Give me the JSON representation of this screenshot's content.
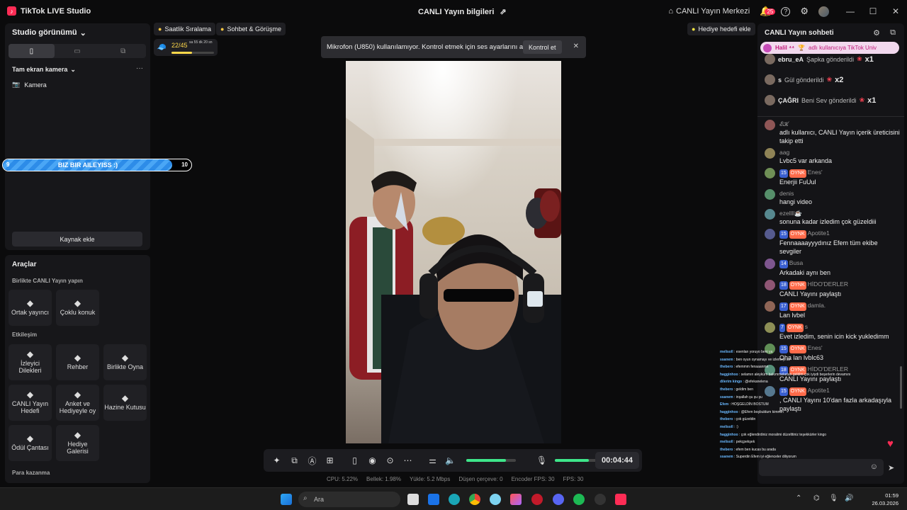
{
  "titlebar": {
    "app_title": "TikTok LIVE Studio",
    "center_title": "CANLI Yayın bilgileri",
    "live_center": "CANLI Yayın Merkezi",
    "notif_count": "25"
  },
  "left": {
    "studio_view": "Studio görünümü",
    "scene": "Tam ekran kamera",
    "source": "Kamera",
    "add_source": "Kaynak ekle",
    "banner_left": "9",
    "banner_text": "BIZ BIR AILEYISS :)",
    "banner_right": "10",
    "banner_progress": 0.9
  },
  "tools": {
    "title": "Araçlar",
    "together_title": "Birlikte CANLI Yayın yapın",
    "together": [
      {
        "label": "Ortak yayıncı",
        "icon": "link-icon"
      },
      {
        "label": "Çoklu konuk",
        "icon": "multi-guest-icon"
      }
    ],
    "engagement_title": "Etkileşim",
    "engagement": [
      {
        "label": "İzleyici Dilekleri",
        "icon": "wishes-icon"
      },
      {
        "label": "Rehber",
        "icon": "guide-icon"
      },
      {
        "label": "Birlikte Oyna",
        "icon": "play-together-icon"
      },
      {
        "label": "CANLI Yayın Hedefi",
        "icon": "goal-icon"
      },
      {
        "label": "Anket ve Hediyeyle oy",
        "icon": "poll-icon"
      },
      {
        "label": "Hazine Kutusu",
        "icon": "treasure-icon"
      },
      {
        "label": "Ödül Çantası",
        "icon": "reward-bag-icon"
      },
      {
        "label": "Hediye Galerisi",
        "icon": "gift-gallery-icon"
      }
    ],
    "monetize_title": "Para kazanma"
  },
  "topbar": {
    "hourly": "Saatlik Sıralama",
    "chat_meet": "Sohbet & Görüşme",
    "gift_goal": "Hediye hedefi ekle",
    "progress_text": "22/45",
    "progress_sub": "sa 55 dk 20 sn",
    "progress_value": 0.49
  },
  "toast": {
    "message": "Mikrofon (U850) kullanılamıyor. Kontrol etmek için ses ayarlarını açın.",
    "button": "Kontrol et"
  },
  "controls": {
    "timer": "00:04:44",
    "volume": 0.8,
    "mic": 0.75
  },
  "stats": {
    "cpu": "CPU:  5.22%",
    "mem": "Bellek:  1.98%",
    "upload": "Yükle:  5.2 Mbps",
    "dropped": "Düşen çerçeve:  0",
    "encoder": "Encoder FPS:  30",
    "fps": "FPS:  30"
  },
  "chat": {
    "title": "CANLI Yayın sohbeti",
    "pinned_name": "Halil ⁴⁴",
    "pinned_text": "adlı kullanıcıya TikTok Univ",
    "gifts": [
      {
        "name": "ebru_eA",
        "text": "Şapka gönderildi",
        "count": "x1"
      },
      {
        "name": "s",
        "text": "Gül gönderildi",
        "count": "x2"
      },
      {
        "name": "ÇAĞRI",
        "text": "Beni Sev gönderildi",
        "count": "x1"
      }
    ],
    "messages": [
      {
        "name": "𝓔𝓚",
        "text": "adlı kullanıcı, CANLI Yayın içerik üreticisini takip etti",
        "lvl": "",
        "fan": ""
      },
      {
        "name": "aag",
        "text": "Lvbc5 var arkanda",
        "lvl": "",
        "fan": ""
      },
      {
        "name": "Enes'",
        "text": "Enerjii FuUul",
        "lvl": "15",
        "fan": "OYNK"
      },
      {
        "name": "denis",
        "text": "hangi video",
        "lvl": "",
        "fan": ""
      },
      {
        "name": "ezellll☕",
        "text": "sonuna kadar izledim çok güzeldiii",
        "lvl": "",
        "fan": ""
      },
      {
        "name": "Apotite1",
        "text": "Fennaaaayyydınız Efem tüm ekibe sevgiler",
        "lvl": "15",
        "fan": "OYNK"
      },
      {
        "name": "Busa",
        "text": "Arkadaki aynı ben",
        "lvl": "14",
        "fan": ""
      },
      {
        "name": "HİDO'DERLER",
        "text": "CANLI Yayını paylaştı",
        "lvl": "18",
        "fan": "OYNK"
      },
      {
        "name": "damla.",
        "text": "Lan lvbel",
        "lvl": "17",
        "fan": "OYNK"
      },
      {
        "name": "s",
        "text": "Evet izledim, senin icin kick yukledimm",
        "lvl": "7",
        "fan": "OYNK"
      },
      {
        "name": "Enes'",
        "text": "Oha lan lvblc63",
        "lvl": "15",
        "fan": "OYNK"
      },
      {
        "name": "HİDO'DERLER",
        "text": "CANLI Yayını paylaştı",
        "lvl": "18",
        "fan": "OYNK"
      },
      {
        "name": "Apotite1",
        "text": ", CANLI Yayını 10'dan fazla arkadaşıyla paylaştı",
        "lvl": "15",
        "fan": "OYNK"
      }
    ]
  },
  "overlay_chat": [
    {
      "u": "melisoll",
      "t": "esenlan yoruyo beni ya"
    },
    {
      "u": "ssanem",
      "t": "ben oyun oynamayı ve izlemeyi sv"
    },
    {
      "u": "thebero",
      "t": "efemmm fenaaanmn"
    },
    {
      "u": "hagginhoo",
      "t": "selamın aleyküm bakımmeketan geldim çok iyiydi beşerlerin devamını"
    },
    {
      "u": "dilerim kingo",
      "t": "@efekanelena"
    },
    {
      "u": "thebero",
      "t": "geldim ben"
    },
    {
      "u": "ssanem",
      "t": "inşallah şu şu şu"
    },
    {
      "u": "Efem",
      "t": "HOŞGELDİN BOSTUM"
    },
    {
      "u": "hagginhoo",
      "t": "@Efem boşbuldum kimmm"
    },
    {
      "u": "thebero",
      "t": "çok güzeldin"
    },
    {
      "u": "melisoll",
      "t": ":)"
    },
    {
      "u": "hagginhoo",
      "t": "çok eğlendirdiniz moralimi düzelttiniz teşekkürler kingo"
    },
    {
      "u": "melisoll",
      "t": "pekçpekşek"
    },
    {
      "u": "thebero",
      "t": "efem ben kucas bu arada"
    },
    {
      "u": "ssanem",
      "t": "Superdin Efem iyi eğlenceler diliyorum"
    }
  ],
  "taskbar": {
    "search": "Ara",
    "time": "01:59",
    "date": "26.03.2026"
  },
  "colors": {
    "accent": "#fe2c55",
    "green": "#3ee68a",
    "banner_blue": "#2d8ce8"
  }
}
